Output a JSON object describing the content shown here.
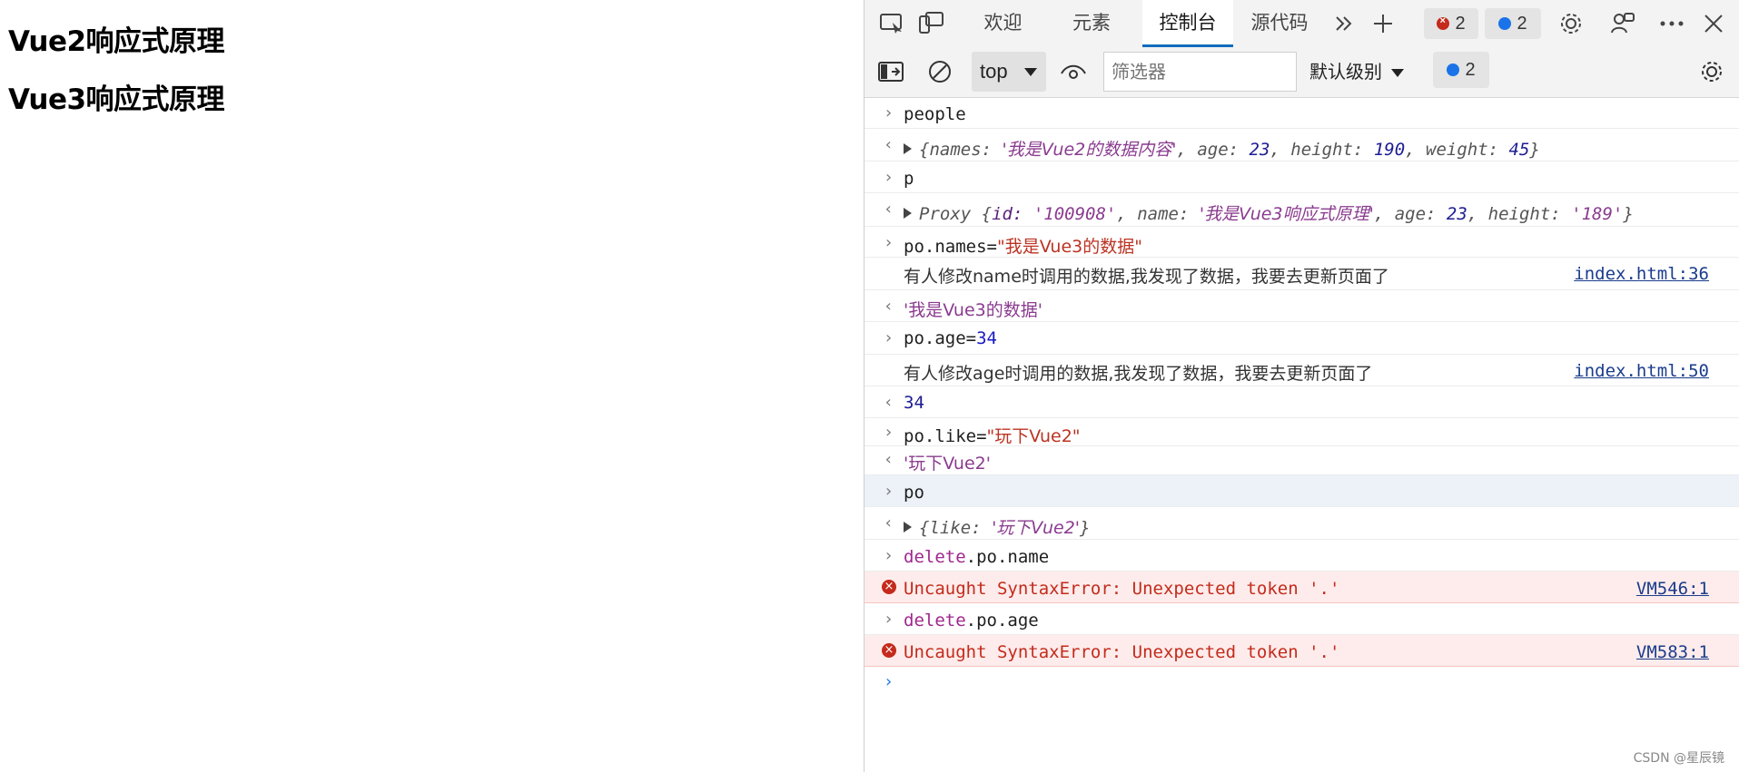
{
  "page": {
    "headings": [
      "Vue2响应式原理",
      "Vue3响应式原理"
    ]
  },
  "devtools": {
    "tabs": {
      "welcome": "欢迎",
      "elements": "元素",
      "console": "控制台",
      "sources": "源代码"
    },
    "error_count": "2",
    "message_count": "2",
    "toolbar": {
      "context": "top",
      "filter_placeholder": "筛选器",
      "level": "默认级别",
      "issue_count": "2"
    },
    "console": {
      "r1_cmd": "people",
      "r2_a": "{names: ",
      "r2_b": "'我是Vue2的数据内容'",
      "r2_c": ", age: ",
      "r2_d": "23",
      "r2_e": ", height: ",
      "r2_f": "190",
      "r2_g": ", weight: ",
      "r2_h": "45",
      "r2_i": "}",
      "r3_cmd": "p",
      "r4_a": "Proxy {",
      "r4_b": "id: ",
      "r4_c": "'100908'",
      "r4_d": ", name: ",
      "r4_e": "'我是Vue3响应式原理'",
      "r4_f": ", age: ",
      "r4_g": "23",
      "r4_h": ", height: ",
      "r4_i": "'189'",
      "r4_j": "}",
      "r5_a": "po.names=",
      "r5_b": "\"我是Vue3的数据\"",
      "r6_log": "有人修改name时调用的数据,我发现了数据，我要去更新页面了",
      "r6_link": "index.html:36",
      "r7_result": "'我是Vue3的数据'",
      "r8_a": "po.age=",
      "r8_b": "34",
      "r9_log": "有人修改age时调用的数据,我发现了数据，我要去更新页面了",
      "r9_link": "index.html:50",
      "r10_result": "34",
      "r11_a": "po.like=",
      "r11_b": "\"玩下Vue2\"",
      "r12_result": "'玩下Vue2'",
      "r13_cmd": "po",
      "r14_a": "{like: ",
      "r14_b": "'玩下Vue2'",
      "r14_c": "}",
      "r15_kw": "delete",
      "r15_rest": ".po.name",
      "r16_err": "Uncaught SyntaxError: Unexpected token '.'",
      "r16_link": "VM546:1",
      "r17_kw": "delete",
      "r17_rest": ".po.age",
      "r18_err": "Uncaught SyntaxError: Unexpected token '.'",
      "r18_link": "VM583:1"
    }
  },
  "watermark": "CSDN @星辰镜",
  "colors": {
    "accent": "#0f6cbd",
    "error": "#c42b1c",
    "badge_blue": "#1a73e8"
  }
}
